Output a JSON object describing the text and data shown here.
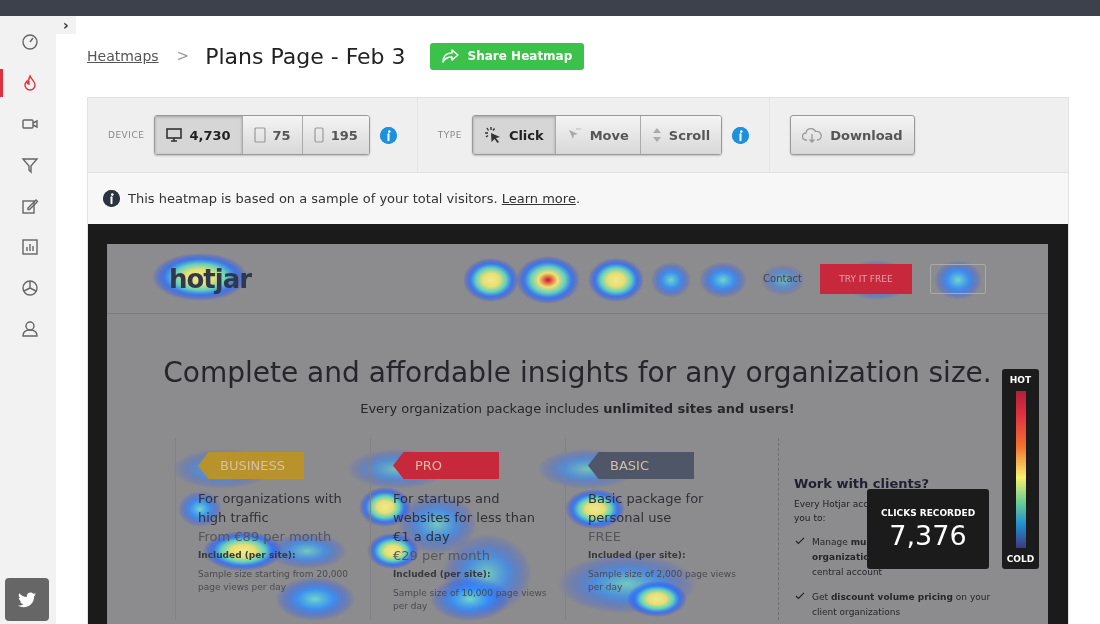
{
  "sidebar": {
    "toggle": "›",
    "items": [
      {
        "kind": "dashboard",
        "selected": false
      },
      {
        "kind": "heatmaps",
        "selected": true
      },
      {
        "kind": "recordings",
        "selected": false
      },
      {
        "kind": "funnels",
        "selected": false
      },
      {
        "kind": "forms",
        "selected": false
      },
      {
        "kind": "analytics",
        "selected": false
      },
      {
        "kind": "polls",
        "selected": false
      },
      {
        "kind": "users",
        "selected": false
      }
    ]
  },
  "breadcrumb": {
    "link": "Heatmaps",
    "separator": ">",
    "title": "Plans Page - Feb 3"
  },
  "share_button": "Share Heatmap",
  "toolbar": {
    "device_label": "DEVICE",
    "devices": [
      {
        "kind": "desktop",
        "count": "4,730",
        "selected": true
      },
      {
        "kind": "tablet",
        "count": "75",
        "selected": false
      },
      {
        "kind": "phone",
        "count": "195",
        "selected": false
      }
    ],
    "type_label": "TYPE",
    "types": [
      {
        "kind": "click",
        "label": "Click",
        "selected": true
      },
      {
        "kind": "move",
        "label": "Move",
        "selected": false
      },
      {
        "kind": "scroll",
        "label": "Scroll",
        "selected": false
      }
    ],
    "download": "Download"
  },
  "notice": {
    "text": "This heatmap is based on a sample of your total visitors.",
    "link": "Learn more",
    "end": "."
  },
  "site": {
    "logo": "hotjar",
    "nav": [
      "Contact"
    ],
    "cta": "TRY IT FREE",
    "headline": "Complete and affordable insights for any organization size.",
    "subline": "Every organization package includes **unlimited sites and users!**",
    "plans": [
      {
        "badge": "BUSINESS",
        "color": "#b8922a",
        "desc": "For organizations with high traffic",
        "price": "From €89 per month",
        "included": "Included (per site):",
        "sample": "Sample size starting from 20,000 page views per day"
      },
      {
        "badge": "PRO",
        "color": "#c8283c",
        "desc": "For startups and websites for less than €1 a day",
        "price": "€29 per month",
        "included": "Included (per site):",
        "sample": "Sample size of 10,000 page views per day"
      },
      {
        "badge": "BASIC",
        "color": "#4e5668",
        "desc": "Basic package for personal use",
        "price": "FREE",
        "included": "Included (per site):",
        "sample": "Sample size of 2,000 page views per day"
      }
    ],
    "clients": {
      "title": "Work with clients?",
      "intro": "Every Hotjar acc\nyou to:",
      "items": [
        "Manage **mu**\n**organizatio**\ncentral account",
        "Get **discount volume pricing** on your client organizations"
      ]
    }
  },
  "clicks": {
    "label": "CLICKS RECORDED",
    "value": "7,376"
  },
  "legend": {
    "hot": "HOT",
    "cold": "COLD"
  }
}
